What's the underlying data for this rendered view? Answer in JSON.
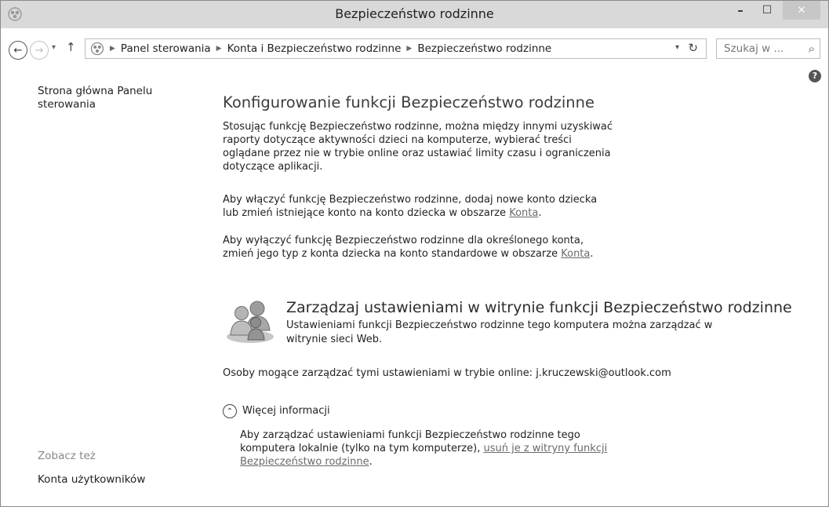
{
  "window": {
    "title": "Bezpieczeństwo rodzinne",
    "minimize": "–",
    "maximize": "☐",
    "close": "✕"
  },
  "nav": {
    "back": "←",
    "forward": "→",
    "history": "▾",
    "up": "↑",
    "breadcrumbs": [
      "Panel sterowania",
      "Konta i Bezpieczeństwo rodzinne",
      "Bezpieczeństwo rodzinne"
    ],
    "search_placeholder": "Szukaj w ..."
  },
  "left": {
    "home": "Strona główna Panelu sterowania",
    "see_also": "Zobacz też",
    "user_accounts": "Konta użytkowników"
  },
  "main": {
    "heading": "Konfigurowanie funkcji Bezpieczeństwo rodzinne",
    "para1": "Stosując funkcję Bezpieczeństwo rodzinne, można między innymi uzyskiwać raporty dotyczące aktywności dzieci na komputerze, wybierać treści oglądane przez nie w trybie online oraz ustawiać limity czasu i ograniczenia dotyczące aplikacji.",
    "para2_text": "Aby włączyć funkcję Bezpieczeństwo rodzinne, dodaj nowe konto dziecka lub zmień istniejące konto na konto dziecka w obszarze ",
    "para2_link": "Konta",
    "para2_end": ".",
    "para3_text": "Aby wyłączyć funkcję Bezpieczeństwo rodzinne dla określonego konta, zmień jego typ z konta dziecka na konto standardowe w obszarze ",
    "para3_link": "Konta",
    "para3_end": ".",
    "web_heading": "Zarządzaj ustawieniami w witrynie funkcji Bezpieczeństwo rodzinne",
    "web_sub": "Ustawieniami funkcji Bezpieczeństwo rodzinne tego komputera można zarządzać w witrynie sieci Web.",
    "owners": "Osoby mogące zarządzać tymi ustawieniami w trybie online: j.kruczewski@outlook.com",
    "more_label": "Więcej informacji",
    "more_text": "Aby zarządzać ustawieniami funkcji Bezpieczeństwo rodzinne tego komputera lokalnie (tylko na tym komputerze), ",
    "more_link": "usuń je z witryny funkcji Bezpieczeństwo rodzinne",
    "more_end": "."
  },
  "colors": {
    "titlebar": "#d9d9d9",
    "link": "#6a6a6a",
    "close_button": "#c7c7c7"
  }
}
